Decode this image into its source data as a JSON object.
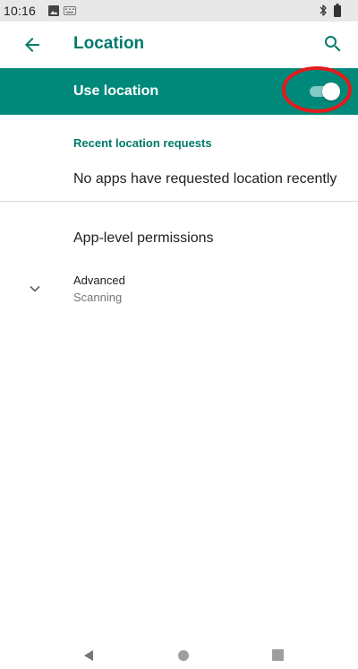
{
  "status_bar": {
    "time": "10:16",
    "icons": [
      "photo-icon",
      "keyboard-icon",
      "bluetooth-icon",
      "battery-icon"
    ]
  },
  "app_bar": {
    "title": "Location",
    "back_icon": "arrow-left-icon",
    "search_icon": "search-icon"
  },
  "master_switch": {
    "label": "Use location",
    "state": "on"
  },
  "recent_requests": {
    "header": "Recent location requests",
    "empty_text": "No apps have requested location recently"
  },
  "items": {
    "app_permissions": "App-level permissions",
    "advanced_title": "Advanced",
    "advanced_summary": "Scanning"
  },
  "nav_bar": {
    "icons": [
      "nav-back-icon",
      "nav-home-icon",
      "nav-recents-icon"
    ]
  },
  "colors": {
    "accent": "#00897b",
    "accent_dark": "#00796b",
    "toggle_track": "#80cbc4",
    "highlight": "#e31b1b"
  }
}
